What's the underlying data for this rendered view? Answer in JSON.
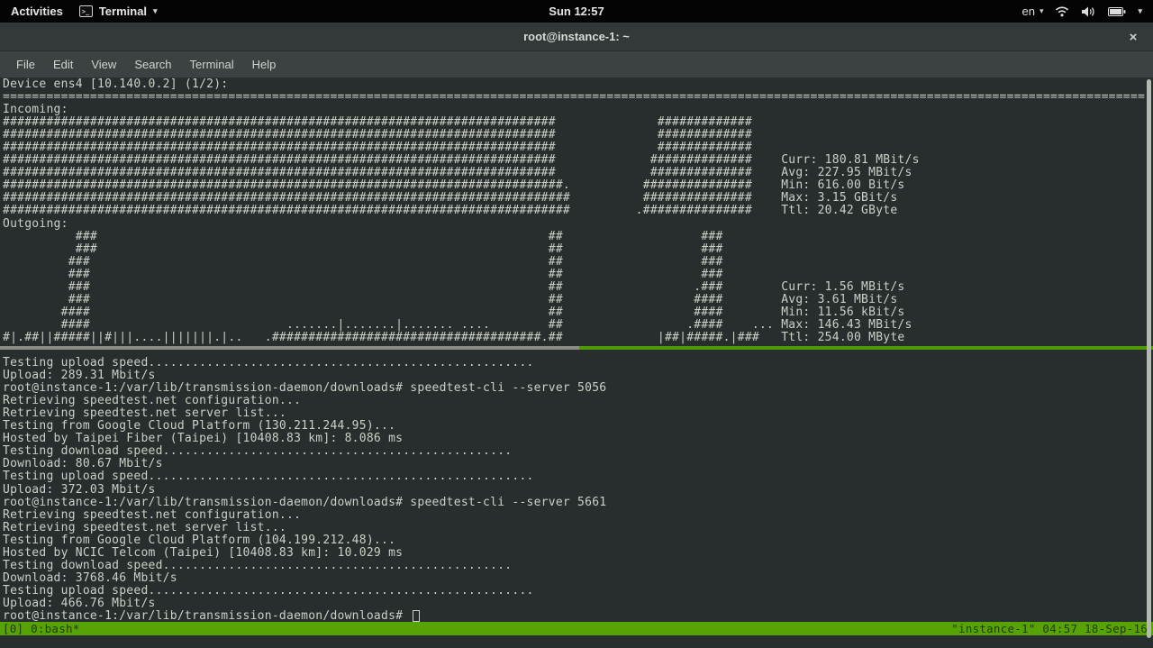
{
  "top_bar": {
    "activities": "Activities",
    "app_name": "Terminal",
    "app_caret": "▾",
    "clock": "Sun 12:57",
    "keyboard_layout": "en",
    "keyboard_caret": "▾",
    "system_caret": "▾",
    "icons": [
      "terminal-icon",
      "wifi-icon",
      "volume-icon",
      "battery-icon"
    ]
  },
  "window": {
    "title": "root@instance-1: ~",
    "close_label": "×",
    "menus": [
      "File",
      "Edit",
      "View",
      "Search",
      "Terminal",
      "Help"
    ]
  },
  "nload": {
    "device_line": "Device ens4 [10.140.0.2] (1/2):",
    "incoming_label": "Incoming:",
    "outgoing_label": "Outgoing:",
    "incoming": {
      "curr": "180.81 MBit/s",
      "avg": "227.95 MBit/s",
      "min": "616.00 Bit/s",
      "max": "3.15 GBit/s",
      "ttl": "20.42 GByte"
    },
    "outgoing": {
      "curr": "1.56 MBit/s",
      "avg": "3.61 MBit/s",
      "min": "11.56 kBit/s",
      "max": "146.43 MBit/s",
      "ttl": "254.00 MByte"
    }
  },
  "speedtests": [
    {
      "server": "5056",
      "host": "Taipei Fiber (Taipei)",
      "distance": "10408.83 km",
      "ping": "8.086 ms",
      "download": "80.67 Mbit/s",
      "upload": "372.03 Mbit/s",
      "from": "Google Cloud Platform (130.211.244.95)"
    },
    {
      "server": "5661",
      "host": "NCIC Telcom (Taipei)",
      "distance": "10408.83 km",
      "ping": "10.029 ms",
      "download": "3768.46 Mbit/s",
      "upload": "466.76 Mbit/s",
      "from": "Google Cloud Platform (104.199.212.48)"
    }
  ],
  "tmux": {
    "left": "[0] 0:bash*",
    "right": "\"instance-1\" 04:57 18-Sep-16"
  },
  "colors": {
    "accent_green": "#4e9a06",
    "tmux_bar_bg": "#57a306",
    "tmux_bar_fg": "#1f3a00",
    "separator_gray": "#8a8d84",
    "terminal_bg": "#282d2d",
    "terminal_fg": "#ccd0c7",
    "topbar_bg": "#040404",
    "titlebar_bg": "#333938",
    "menubar_bg": "#3c4241"
  },
  "terminal": {
    "rows": [
      [
        "Device ens4 [10.140.0.2] (1/2):"
      ],
      [
        [
          "=",
          157
        ]
      ],
      [
        "Incoming:"
      ],
      [
        [
          "#",
          76
        ],
        [
          " ",
          14
        ],
        [
          "#",
          13
        ]
      ],
      [
        [
          "#",
          76
        ],
        [
          " ",
          14
        ],
        [
          "#",
          13
        ]
      ],
      [
        [
          "#",
          76
        ],
        [
          " ",
          14
        ],
        [
          "#",
          13
        ]
      ],
      [
        [
          "#",
          76
        ],
        [
          " ",
          13
        ],
        [
          "#",
          14
        ],
        [
          " ",
          4
        ],
        "Curr: 180.81 MBit/s"
      ],
      [
        [
          "#",
          76
        ],
        [
          " ",
          13
        ],
        [
          "#",
          14
        ],
        [
          " ",
          4
        ],
        "Avg: 227.95 MBit/s"
      ],
      [
        [
          "#",
          77
        ],
        ".",
        [
          " ",
          10
        ],
        [
          "#",
          15
        ],
        [
          " ",
          4
        ],
        "Min: 616.00 Bit/s"
      ],
      [
        [
          "#",
          78
        ],
        [
          " ",
          10
        ],
        [
          "#",
          15
        ],
        [
          " ",
          4
        ],
        "Max: 3.15 GBit/s"
      ],
      [
        [
          "#",
          78
        ],
        [
          " ",
          9
        ],
        ".",
        [
          "#",
          15
        ],
        [
          " ",
          4
        ],
        "Ttl: 20.42 GByte"
      ],
      [
        "Outgoing:"
      ],
      [
        [
          " ",
          10
        ],
        "###",
        [
          " ",
          62
        ],
        "##",
        [
          " ",
          19
        ],
        "###"
      ],
      [
        [
          " ",
          10
        ],
        "###",
        [
          " ",
          62
        ],
        "##",
        [
          " ",
          19
        ],
        "###"
      ],
      [
        [
          " ",
          9
        ],
        "###",
        [
          " ",
          63
        ],
        "##",
        [
          " ",
          19
        ],
        "###"
      ],
      [
        [
          " ",
          9
        ],
        "###",
        [
          " ",
          63
        ],
        "##",
        [
          " ",
          19
        ],
        "###"
      ],
      [
        [
          " ",
          9
        ],
        "###",
        [
          " ",
          63
        ],
        "##",
        [
          " ",
          18
        ],
        ".###",
        [
          " ",
          8
        ],
        "Curr: 1.56 MBit/s"
      ],
      [
        [
          " ",
          9
        ],
        "###",
        [
          " ",
          63
        ],
        "##",
        [
          " ",
          18
        ],
        "####",
        [
          " ",
          8
        ],
        "Avg: 3.61 MBit/s"
      ],
      [
        [
          " ",
          8
        ],
        "####",
        [
          " ",
          63
        ],
        "##",
        [
          " ",
          18
        ],
        "####",
        [
          " ",
          8
        ],
        "Min: 11.56 kBit/s"
      ],
      [
        [
          " ",
          8
        ],
        "####",
        [
          " ",
          27
        ],
        ".......|.......|.......",
        " ",
        "....",
        [
          " ",
          8
        ],
        "##",
        [
          " ",
          17
        ],
        ".####",
        [
          " ",
          4
        ],
        "...",
        [
          " ",
          1
        ],
        "Max: 146.43 MBit/s"
      ],
      [
        "#|.##||#####||#|||....|||||||.|..",
        [
          " ",
          3
        ],
        ".",
        [
          "#",
          37
        ],
        ".",
        "##",
        [
          " ",
          13
        ],
        "|##|#####.|###",
        [
          " ",
          3
        ],
        "Ttl: 254.00 MByte"
      ],
      [
        ""
      ],
      [
        "Testing upload speed",
        [
          ".",
          53
        ]
      ],
      [
        "Upload: 289.31 Mbit/s"
      ],
      [
        "root@instance-1:/var/lib/transmission-daemon/downloads# speedtest-cli --server 5056"
      ],
      [
        "Retrieving speedtest.net configuration..."
      ],
      [
        "Retrieving speedtest.net server list..."
      ],
      [
        "Testing from Google Cloud Platform (130.211.244.95)..."
      ],
      [
        "Hosted by Taipei Fiber (Taipei) [10408.83 km]: 8.086 ms"
      ],
      [
        "Testing download speed",
        [
          ".",
          48
        ]
      ],
      [
        "Download: 80.67 Mbit/s"
      ],
      [
        "Testing upload speed",
        [
          ".",
          53
        ]
      ],
      [
        "Upload: 372.03 Mbit/s"
      ],
      [
        "root@instance-1:/var/lib/transmission-daemon/downloads# speedtest-cli --server 5661"
      ],
      [
        "Retrieving speedtest.net configuration..."
      ],
      [
        "Retrieving speedtest.net server list..."
      ],
      [
        "Testing from Google Cloud Platform (104.199.212.48)..."
      ],
      [
        "Hosted by NCIC Telcom (Taipei) [10408.83 km]: 10.029 ms"
      ],
      [
        "Testing download speed",
        [
          ".",
          48
        ]
      ],
      [
        "Download: 3768.46 Mbit/s"
      ],
      [
        "Testing upload speed",
        [
          ".",
          53
        ]
      ],
      [
        "Upload: 466.76 Mbit/s"
      ],
      [
        "root@instance-1:/var/lib/transmission-daemon/downloads# "
      ]
    ]
  }
}
